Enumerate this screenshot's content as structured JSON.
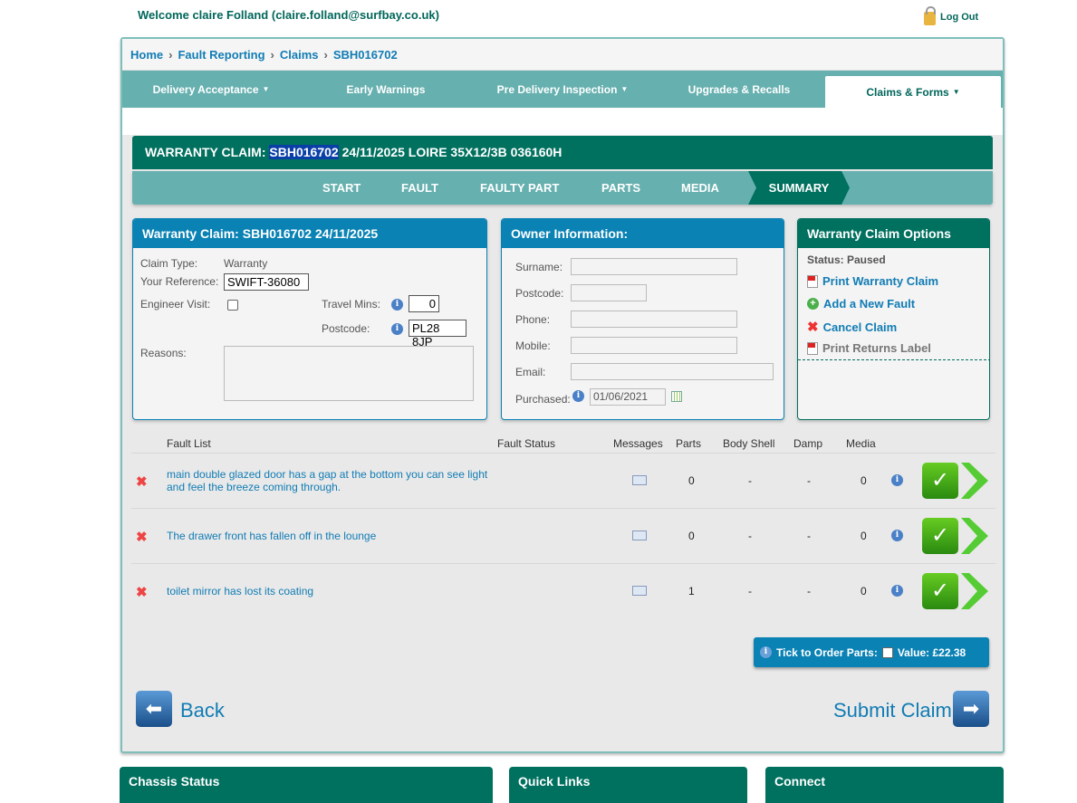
{
  "header": {
    "welcome": "Welcome claire Folland (claire.folland@surfbay.co.uk)",
    "logout": "Log Out"
  },
  "breadcrumb": [
    "Home",
    "Fault Reporting",
    "Claims",
    "SBH016702"
  ],
  "nav": [
    {
      "label": "Delivery Acceptance",
      "dropdown": true
    },
    {
      "label": "Early Warnings",
      "dropdown": false
    },
    {
      "label": "Pre Delivery Inspection",
      "dropdown": true
    },
    {
      "label": "Upgrades & Recalls",
      "dropdown": false
    },
    {
      "label": "Claims & Forms",
      "dropdown": true,
      "active": true
    }
  ],
  "title": {
    "prefix": "WARRANTY CLAIM:",
    "claim_no": "SBH016702",
    "rest": "24/11/2025 LOIRE 35X12/3B 036160H"
  },
  "steps": [
    "START",
    "FAULT",
    "FAULTY PART",
    "PARTS",
    "MEDIA",
    "SUMMARY"
  ],
  "active_step": "SUMMARY",
  "claim_panel": {
    "title": "Warranty Claim: SBH016702 24/11/2025",
    "claim_type_label": "Claim Type:",
    "claim_type": "Warranty",
    "reference_label": "Your Reference:",
    "reference": "SWIFT-36080",
    "engineer_label": "Engineer Visit:",
    "engineer_visit": false,
    "travel_label": "Travel Mins:",
    "travel_mins": "0",
    "postcode_label": "Postcode:",
    "postcode": "PL28 8JP",
    "reasons_label": "Reasons:",
    "reasons": ""
  },
  "owner_panel": {
    "title": "Owner Information:",
    "surname_label": "Surname:",
    "postcode_label": "Postcode:",
    "phone_label": "Phone:",
    "mobile_label": "Mobile:",
    "email_label": "Email:",
    "purchased_label": "Purchased:",
    "purchased": "01/06/2021"
  },
  "options_panel": {
    "title": "Warranty Claim Options",
    "status": "Status: Paused",
    "items": [
      "Print Warranty Claim",
      "Add a New Fault",
      "Cancel Claim",
      "Print Returns Label"
    ]
  },
  "fault_table": {
    "headers": [
      "Fault List",
      "Fault Status",
      "Messages",
      "Parts",
      "Body Shell",
      "Damp",
      "Media"
    ],
    "rows": [
      {
        "desc": "main double glazed door has a gap at the bottom you can see light and feel the breeze coming through.",
        "status": "",
        "parts": "0",
        "body_shell": "-",
        "damp": "-",
        "media": "0"
      },
      {
        "desc": "The drawer front has fallen off in the lounge",
        "status": "",
        "parts": "0",
        "body_shell": "-",
        "damp": "-",
        "media": "0"
      },
      {
        "desc": "toilet mirror has lost its coating",
        "status": "",
        "parts": "1",
        "body_shell": "-",
        "damp": "-",
        "media": "0"
      }
    ]
  },
  "parts_order": {
    "label": "Tick to Order Parts:",
    "value": "Value: £22.38",
    "checked": false
  },
  "actions": {
    "back": "Back",
    "submit": "Submit Claim"
  },
  "footer": [
    "Chassis Status",
    "Quick Links",
    "Connect"
  ],
  "colors": {
    "dark_teal": "#00705f",
    "teal": "#66b0af",
    "blue": "#0a82b4",
    "link": "#117cb4"
  }
}
